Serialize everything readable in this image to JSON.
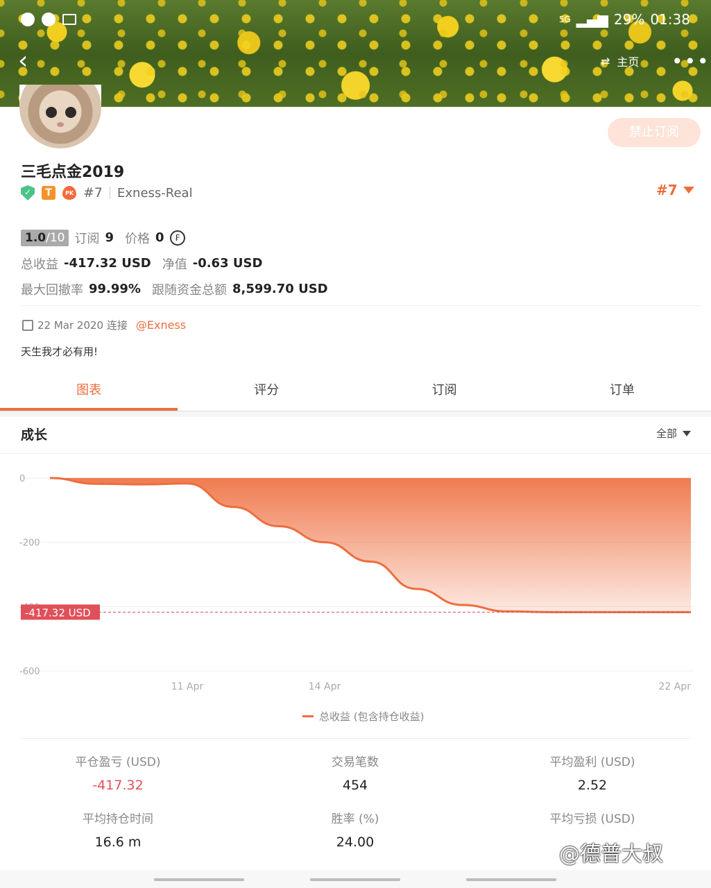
{
  "status_bar": {
    "network": "5G",
    "battery": "29%",
    "time": "01:38"
  },
  "header": {
    "home_label": "主页"
  },
  "profile": {
    "name": "三毛点金2019",
    "rank": "#7",
    "broker": "Exness-Real",
    "block_button": "禁止订阅",
    "rank_right": "#7",
    "score_value": "1.0",
    "score_max": "/10",
    "subs_label": "订阅",
    "subs_value": "9",
    "price_label": "价格",
    "price_value": "0",
    "total_profit_label": "总收益",
    "total_profit_value": "-417.32 USD",
    "equity_label": "净值",
    "equity_value": "-0.63 USD",
    "drawdown_label": "最大回撤率",
    "drawdown_value": "99.99%",
    "follow_label": "跟随资金总额",
    "follow_value": "8,599.70 USD",
    "joined": "22 Mar 2020 连接",
    "via": "@Exness",
    "bio": "天生我才必有用!"
  },
  "tabs": [
    "图表",
    "评分",
    "订阅",
    "订单"
  ],
  "growth": {
    "title": "成长",
    "range": "全部"
  },
  "chart_data": {
    "type": "area",
    "x": [
      "8 Apr",
      "9 Apr",
      "10 Apr",
      "11 Apr",
      "12 Apr",
      "13 Apr",
      "14 Apr",
      "15 Apr",
      "16 Apr",
      "17 Apr",
      "18 Apr",
      "19 Apr",
      "20 Apr",
      "21 Apr",
      "22 Apr"
    ],
    "y": [
      0,
      -18,
      -20,
      -17,
      -90,
      -150,
      -200,
      -260,
      -345,
      -395,
      -415,
      -417.32,
      -417.32,
      -417.32,
      -417.32
    ],
    "x_ticks": [
      "11 Apr",
      "14 Apr",
      "22 Apr"
    ],
    "y_ticks": [
      "0",
      "-200",
      "-400",
      "-600"
    ],
    "ylim": [
      -600,
      0
    ],
    "current_label": "-417.32 USD",
    "current_value": -417.32,
    "series_name": "总收益 (包含持仓收益)",
    "color": "#ee6d3d"
  },
  "metrics": [
    {
      "label": "平仓盈亏 (USD)",
      "value": "-417.32",
      "negative": true
    },
    {
      "label": "交易笔数",
      "value": "454"
    },
    {
      "label": "平均盈利 (USD)",
      "value": "2.52"
    },
    {
      "label": "平均持仓时间",
      "value": "16.6 m"
    },
    {
      "label": "胜率 (%)",
      "value": "24.00"
    },
    {
      "label": "平均亏损 (USD)",
      "value": ""
    }
  ],
  "watermark": "@德普大叔"
}
